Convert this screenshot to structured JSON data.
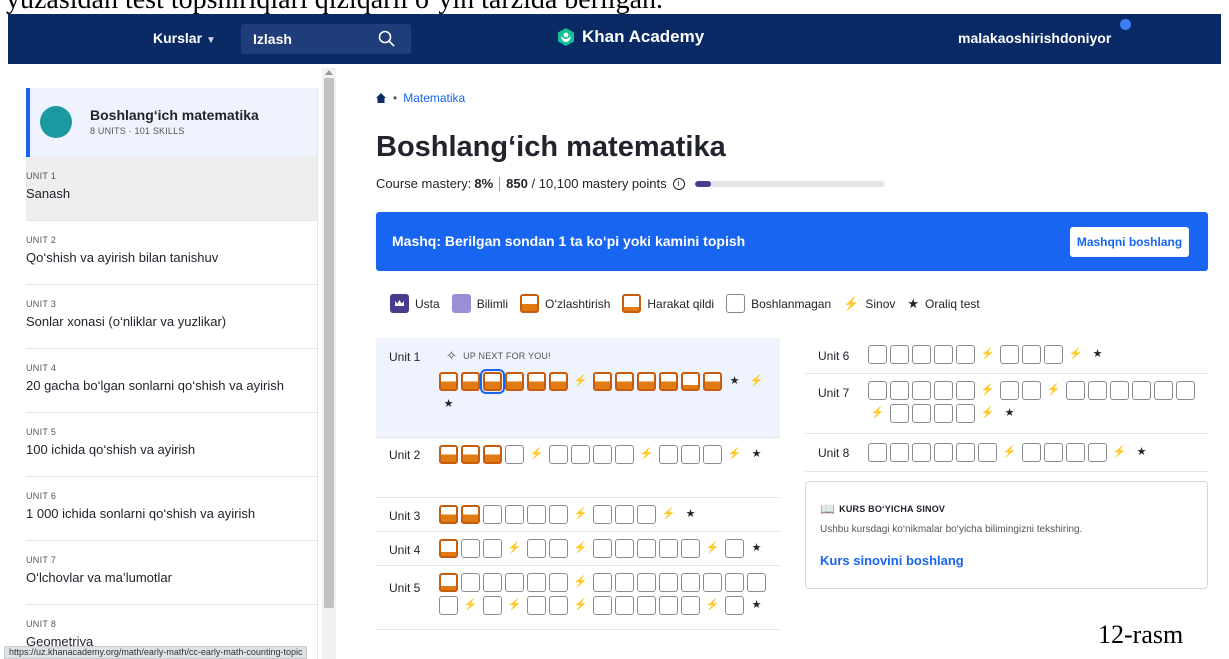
{
  "doc": {
    "top_text": "yuzasidan test topshiriqlari qiziqarli o‘yin tarzida berilgan.",
    "figure_caption": "12-rasm"
  },
  "nav": {
    "courses": "Kurslar",
    "search_text": "Izlash",
    "logo": "Khan Academy",
    "user": "malakaoshirishdoniyor"
  },
  "sidebar": {
    "course_title": "Boshlang‘ich matematika",
    "course_sub": "8 UNITS · 101 SKILLS",
    "units": [
      {
        "label": "UNIT 1",
        "name": "Sanash"
      },
      {
        "label": "UNIT 2",
        "name": "Qo‘shish va ayirish bilan tanishuv"
      },
      {
        "label": "UNIT 3",
        "name": "Sonlar xonasi (o‘nliklar va yuzlikar)"
      },
      {
        "label": "UNIT 4",
        "name": "20 gacha bo‘lgan sonlarni qo‘shish va ayirish"
      },
      {
        "label": "UNIT 5",
        "name": "100 ichida qo‘shish va ayirish"
      },
      {
        "label": "UNIT 6",
        "name": "1 000 ichida sonlarni qo‘shish va ayirish"
      },
      {
        "label": "UNIT 7",
        "name": "O‘lchovlar va ma’lumotlar"
      },
      {
        "label": "UNIT 8",
        "name": "Geometriya"
      }
    ]
  },
  "status_url": "https://uz.khanacademy.org/math/early-math/cc-early-math-counting-topic",
  "main": {
    "breadcrumb": "Matematika",
    "title": "Boshlang‘ich matematika",
    "mastery_label": "Course mastery:",
    "mastery_pct": "8%",
    "mastery_points": "850",
    "mastery_points_rest": " / 10,100 mastery points",
    "mastery_fraction": 0.084,
    "banner_text": "Mashq: Berilgan sondan 1 ta ko‘pi yoki kamini topish",
    "banner_button": "Mashqni boshlang",
    "legend": {
      "usta": "Usta",
      "bilimli": "Bilimli",
      "ozl": "O‘zlashtirish",
      "harakat": "Harakat qildi",
      "bosh": "Boshlanmagan",
      "sinov": "Sinov",
      "oraliq": "Oraliq test"
    },
    "up_next": "UP NEXT FOR YOU!",
    "units_left": [
      "Unit 1",
      "Unit 2",
      "Unit 3",
      "Unit 4",
      "Unit 5"
    ],
    "units_right": [
      "Unit 6",
      "Unit 7",
      "Unit 8"
    ],
    "card": {
      "title": "KURS BO‘YICHA SINOV",
      "desc": "Ushbu kursdagi ko‘nikmalar bo‘yicha bilimingizni tekshiring.",
      "link": "Kurs sinovini boshlang"
    }
  },
  "colors": {
    "nav": "#0a2a66",
    "accent": "#1865f2",
    "mastered": "#4a3b8f",
    "proficient": "#9b8ed6",
    "familiar": "#e07b13"
  }
}
